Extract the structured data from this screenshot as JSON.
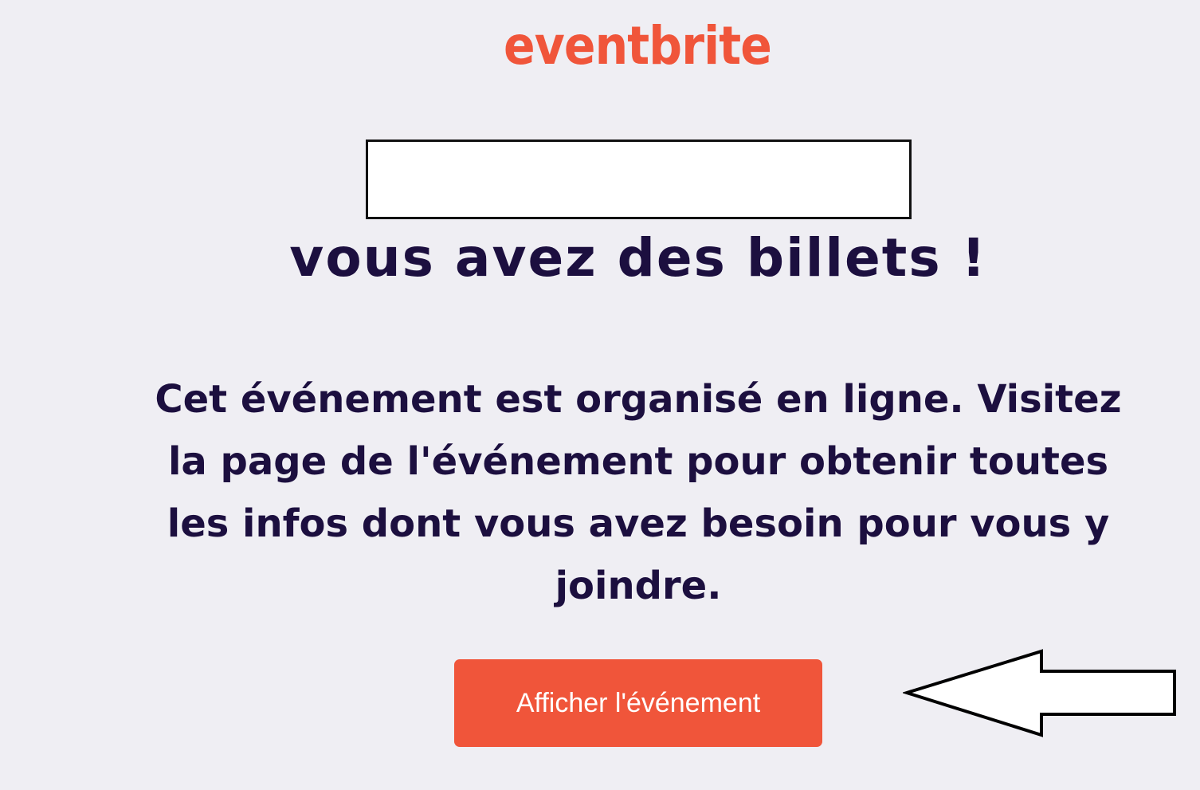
{
  "brand": {
    "logo_text": "eventbrite",
    "color": "#f0553a"
  },
  "content": {
    "headline": "vous avez des billets !",
    "message": "Cet événement est organisé en ligne. Visitez la page de l'événement pour obtenir toutes les infos dont vous avez besoin pour vous y joindre."
  },
  "actions": {
    "view_event_label": "Afficher l'événement"
  },
  "colors": {
    "background": "#efeef3",
    "text": "#1c0f3f",
    "button": "#f0553a",
    "button_text": "#ffffff"
  },
  "icons": {
    "annotation_arrow": "left-arrow-icon"
  }
}
